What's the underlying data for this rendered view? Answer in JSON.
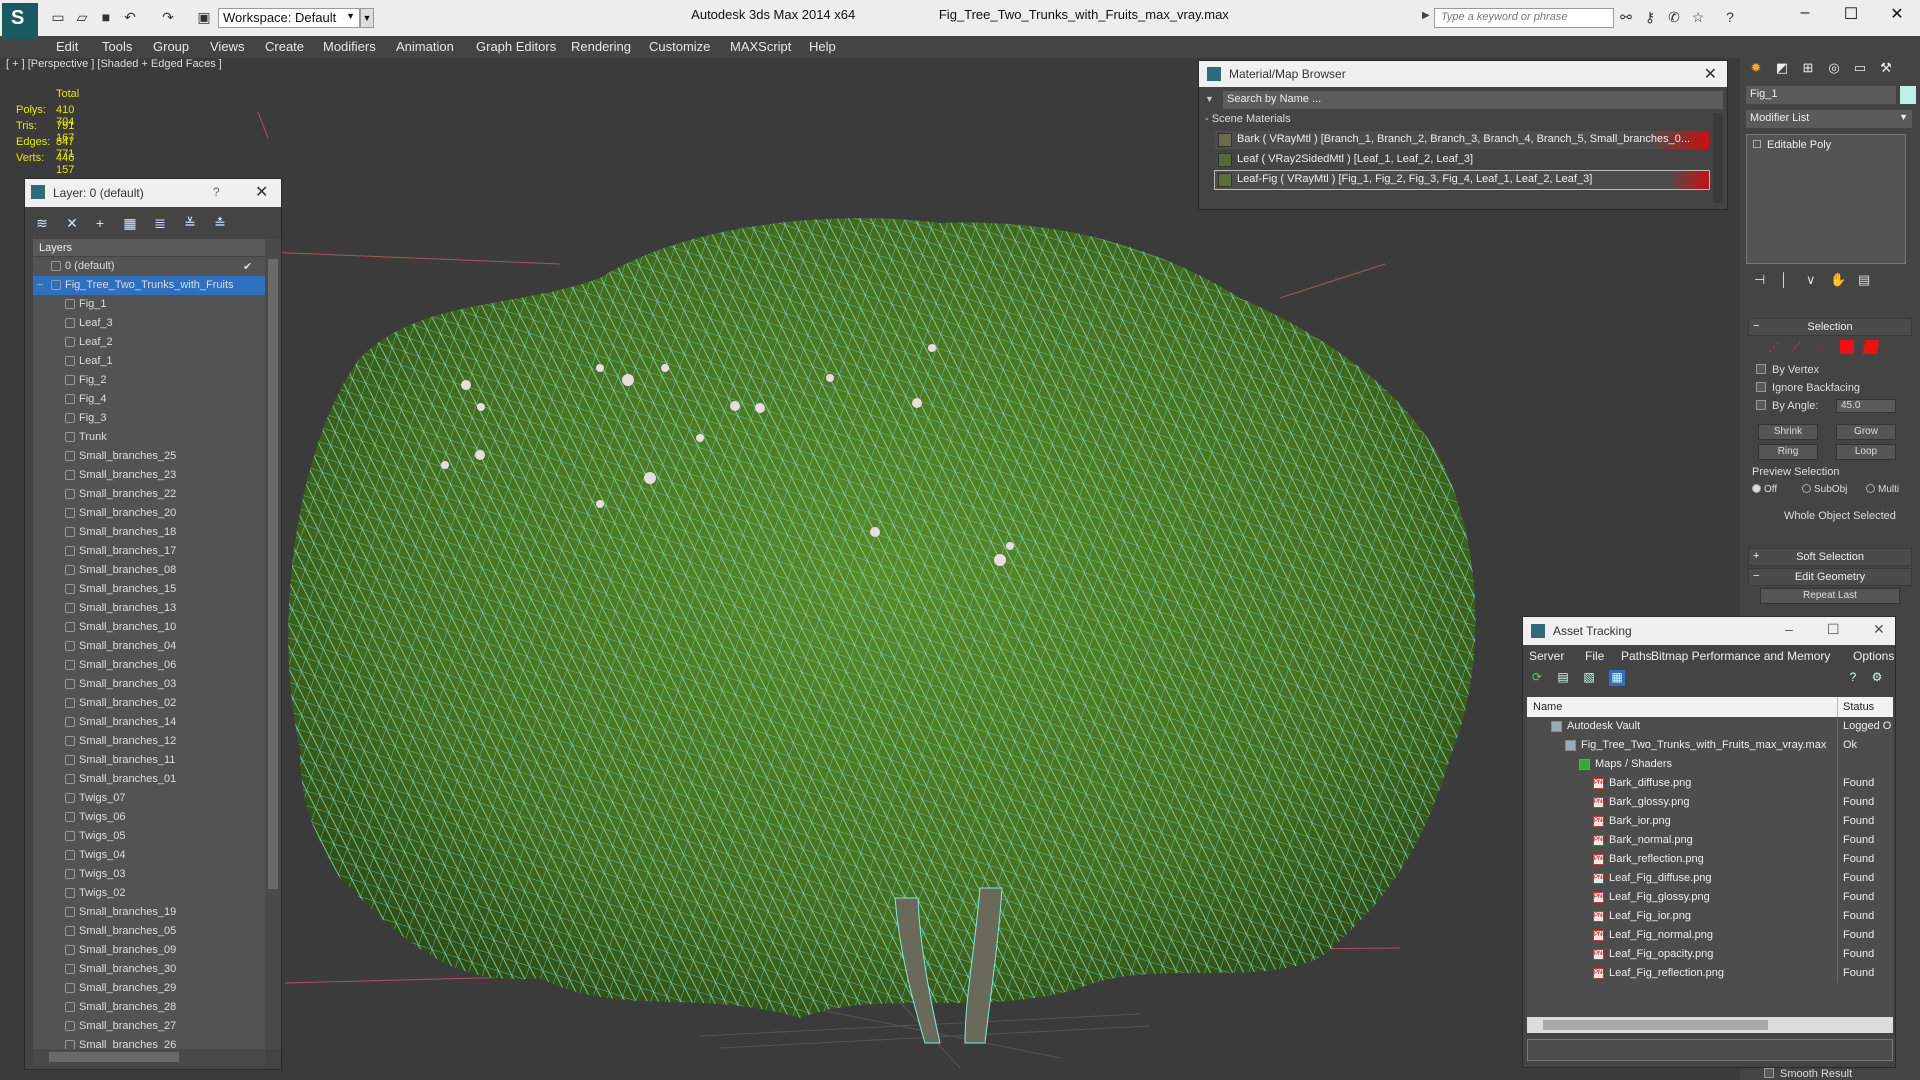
{
  "titlebar": {
    "app_title": "Autodesk 3ds Max  2014 x64",
    "file_name": "Fig_Tree_Two_Trunks_with_Fruits_max_vray.max",
    "workspace_label": "Workspace: Default",
    "search_placeholder": "Type a keyword or phrase"
  },
  "menu": [
    "Edit",
    "Tools",
    "Group",
    "Views",
    "Create",
    "Modifiers",
    "Animation",
    "Graph Editors",
    "Rendering",
    "Customize",
    "MAXScript",
    "Help"
  ],
  "viewport": {
    "label": "[ + ] [Perspective ] [Shaded + Edged Faces ]",
    "stats": {
      "total_label": "Total",
      "rows": [
        {
          "k": "Polys:",
          "v": "410 704"
        },
        {
          "k": "Tris:",
          "v": "791 167"
        },
        {
          "k": "Edges:",
          "v": "847 771"
        },
        {
          "k": "Verts:",
          "v": "446 157"
        }
      ]
    }
  },
  "layer_panel": {
    "title": "Layer: 0 (default)",
    "help": "?",
    "list_header": "Layers",
    "default_layer": "0 (default)",
    "selected_layer": "Fig_Tree_Two_Trunks_with_Fruits",
    "objects": [
      "Fig_1",
      "Leaf_3",
      "Leaf_2",
      "Leaf_1",
      "Fig_2",
      "Fig_4",
      "Fig_3",
      "Trunk",
      "Small_branches_25",
      "Small_branches_23",
      "Small_branches_22",
      "Small_branches_20",
      "Small_branches_18",
      "Small_branches_17",
      "Small_branches_08",
      "Small_branches_15",
      "Small_branches_13",
      "Small_branches_10",
      "Small_branches_04",
      "Small_branches_06",
      "Small_branches_03",
      "Small_branches_02",
      "Small_branches_14",
      "Small_branches_12",
      "Small_branches_11",
      "Small_branches_01",
      "Twigs_07",
      "Twigs_06",
      "Twigs_05",
      "Twigs_04",
      "Twigs_03",
      "Twigs_02",
      "Small_branches_19",
      "Small_branches_05",
      "Small_branches_09",
      "Small_branches_30",
      "Small_branches_29",
      "Small_branches_28",
      "Small_branches_27",
      "Small_branches_26"
    ]
  },
  "material_browser": {
    "title": "Material/Map Browser",
    "search_placeholder": "Search by Name ...",
    "section": "- Scene Materials",
    "materials": [
      "Bark  ( VRayMtl )  [Branch_1, Branch_2, Branch_3, Branch_4, Branch_5, Small_branches_0...",
      "Leaf  ( VRay2SidedMtl ) [Leaf_1, Leaf_2, Leaf_3]",
      "Leaf-Fig  ( VRayMtl ) [Fig_1, Fig_2, Fig_3, Fig_4, Leaf_1, Leaf_2, Leaf_3]"
    ]
  },
  "command_panel": {
    "object_name": "Fig_1",
    "modifier_list": "Modifier List",
    "stack_item": "Editable Poly",
    "selection_title": "Selection",
    "by_vertex": "By Vertex",
    "ignore_backfacing": "Ignore Backfacing",
    "by_angle": "By Angle:",
    "angle_value": "45.0",
    "shrink": "Shrink",
    "grow": "Grow",
    "ring": "Ring",
    "loop": "Loop",
    "preview_selection": "Preview Selection",
    "preview_off": "Off",
    "preview_subobj": "SubObj",
    "preview_multi": "Multi",
    "whole_object": "Whole Object Selected",
    "soft_selection": "Soft Selection",
    "edit_geometry": "Edit Geometry",
    "repeat_last": "Repeat Last",
    "smooth_result": "Smooth Result"
  },
  "asset_tracking": {
    "title": "Asset Tracking",
    "menu": [
      "Server",
      "File",
      "Paths",
      "Bitmap Performance and Memory",
      "Options"
    ],
    "col_name": "Name",
    "col_status": "Status",
    "rows": [
      {
        "name": "Autodesk Vault",
        "status": "Logged O",
        "indent": 0
      },
      {
        "name": "Fig_Tree_Two_Trunks_with_Fruits_max_vray.max",
        "status": "Ok",
        "indent": 1
      },
      {
        "name": "Maps / Shaders",
        "status": "",
        "indent": 2
      },
      {
        "name": "Bark_diffuse.png",
        "status": "Found",
        "indent": 3
      },
      {
        "name": "Bark_glossy.png",
        "status": "Found",
        "indent": 3
      },
      {
        "name": "Bark_ior.png",
        "status": "Found",
        "indent": 3
      },
      {
        "name": "Bark_normal.png",
        "status": "Found",
        "indent": 3
      },
      {
        "name": "Bark_reflection.png",
        "status": "Found",
        "indent": 3
      },
      {
        "name": "Leaf_Fig_diffuse.png",
        "status": "Found",
        "indent": 3
      },
      {
        "name": "Leaf_Fig_glossy.png",
        "status": "Found",
        "indent": 3
      },
      {
        "name": "Leaf_Fig_ior.png",
        "status": "Found",
        "indent": 3
      },
      {
        "name": "Leaf_Fig_normal.png",
        "status": "Found",
        "indent": 3
      },
      {
        "name": "Leaf_Fig_opacity.png",
        "status": "Found",
        "indent": 3
      },
      {
        "name": "Leaf_Fig_reflection.png",
        "status": "Found",
        "indent": 3
      }
    ]
  },
  "colors": {
    "viewport_bg": "#3b3b3b",
    "wireframe": "#7fe8e0",
    "foliage": "#4e7a22",
    "selection_blue": "#2f6fbf",
    "stats_yellow": "#e8e800",
    "material_red": "#c81010"
  }
}
